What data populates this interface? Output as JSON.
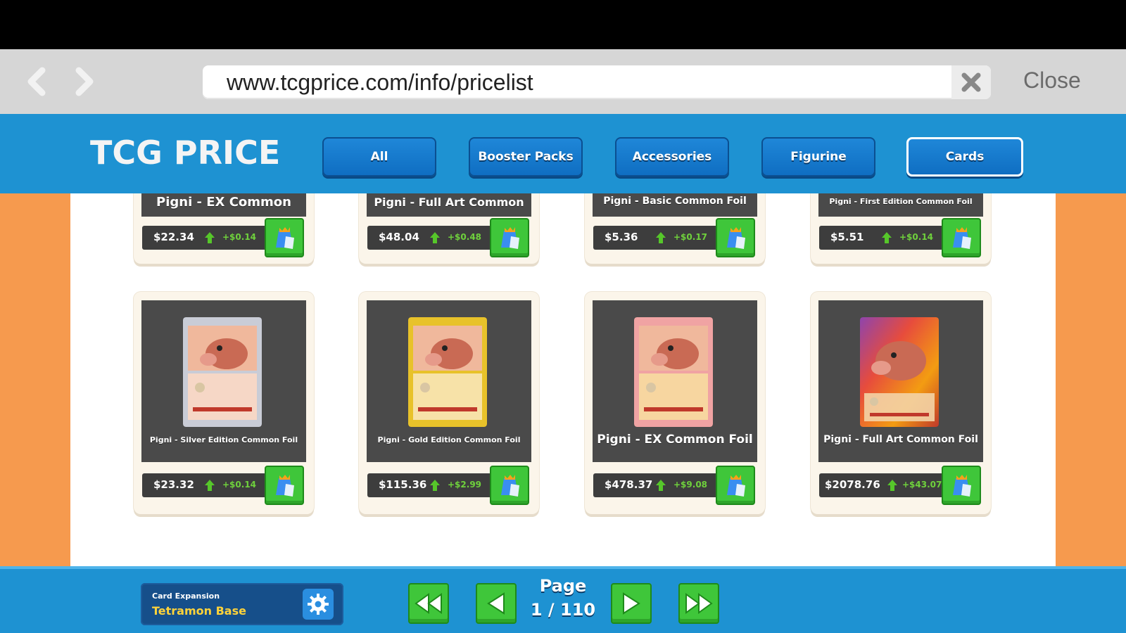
{
  "browser": {
    "url": "www.tcgprice.com/info/pricelist",
    "close_label": "Close"
  },
  "header": {
    "logo": "TCG PRICE",
    "tabs": [
      {
        "label": "All"
      },
      {
        "label": "Booster Packs"
      },
      {
        "label": "Accessories"
      },
      {
        "label": "Figurine"
      },
      {
        "label": "Cards",
        "active": true
      }
    ]
  },
  "cards": [
    {
      "name": "Pigni - EX Common",
      "price": "$22.34",
      "change": "+$0.14"
    },
    {
      "name": "Pigni - Full Art Common",
      "price": "$48.04",
      "change": "+$0.48"
    },
    {
      "name": "Pigni - Basic Common Foil",
      "price": "$5.36",
      "change": "+$0.17"
    },
    {
      "name": "Pigni - First Edition Common Foil",
      "price": "$5.51",
      "change": "+$0.14"
    },
    {
      "name": "Pigni - Silver Edition Common Foil",
      "price": "$23.32",
      "change": "+$0.14",
      "frame_color": "#c9ccd6"
    },
    {
      "name": "Pigni - Gold Edition Common Foil",
      "price": "$115.36",
      "change": "+$2.99",
      "frame_color": "#e8c22a"
    },
    {
      "name": "Pigni - EX Common Foil",
      "price": "$478.37",
      "change": "+$9.08",
      "frame_color": "#f0a3a3"
    },
    {
      "name": "Pigni - Full Art Common Foil",
      "price": "$2078.76",
      "change": "+$43.07",
      "frame_color": "#c0392b"
    }
  ],
  "footer": {
    "expansion_label": "Card Expansion",
    "expansion_value": "Tetramon Base",
    "page_label": "Page",
    "page_value": "1 / 110"
  },
  "colors": {
    "header_blue": "#1e92d2",
    "side_orange": "#f69a4e",
    "buy_green": "#3fc63a",
    "change_green": "#6fd13c"
  }
}
